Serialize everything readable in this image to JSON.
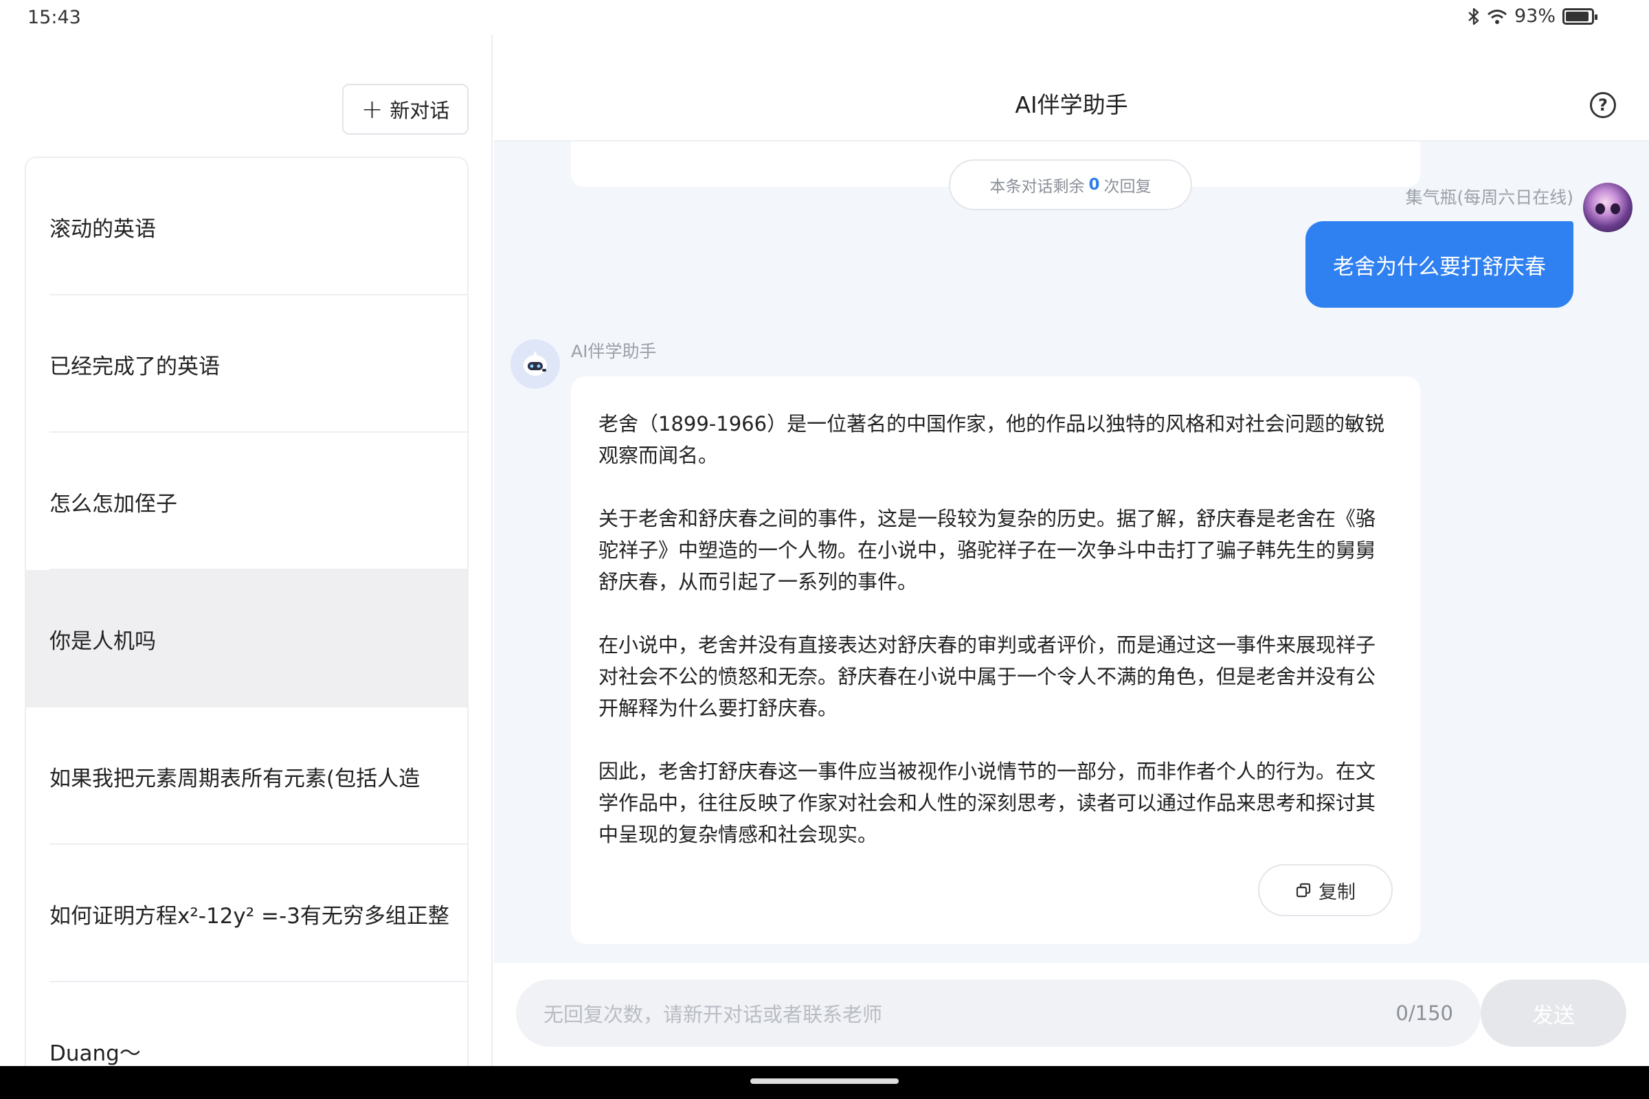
{
  "status_bar": {
    "time": "15:43",
    "battery_percent": "93%",
    "battery_level": 0.93,
    "icons": [
      "bluetooth-icon",
      "wifi-icon",
      "battery-icon"
    ]
  },
  "sidebar": {
    "new_chat_label": "新对话",
    "conversations": [
      {
        "title": "滚动的英语",
        "active": false
      },
      {
        "title": "已经完成了的英语",
        "active": false
      },
      {
        "title": "怎么怎加侄子",
        "active": false
      },
      {
        "title": "你是人机吗",
        "active": true
      },
      {
        "title": "如果我把元素周期表所有元素(包括人造",
        "active": false
      },
      {
        "title": "如何证明方程x²-12y² =-3有无穷多组正整",
        "active": false
      },
      {
        "title": "Duang～",
        "active": false
      }
    ]
  },
  "header": {
    "title": "AI伴学助手"
  },
  "chat": {
    "remaining": {
      "prefix": "本条对话剩余",
      "count": "0",
      "suffix": "次回复"
    },
    "user": {
      "name": "集气瓶(每周六日在线)",
      "message": "老舍为什么要打舒庆春"
    },
    "bot": {
      "name": "AI伴学助手",
      "paragraphs": [
        "老舍（1899-1966）是一位著名的中国作家，他的作品以独特的风格和对社会问题的敏锐观察而闻名。",
        "关于老舍和舒庆春之间的事件，这是一段较为复杂的历史。据了解，舒庆春是老舍在《骆驼祥子》中塑造的一个人物。在小说中，骆驼祥子在一次争斗中击打了骗子韩先生的舅舅舒庆春，从而引起了一系列的事件。",
        "在小说中，老舍并没有直接表达对舒庆春的审判或者评价，而是通过这一事件来展现祥子对社会不公的愤怒和无奈。舒庆春在小说中属于一个令人不满的角色，但是老舍并没有公开解释为什么要打舒庆春。",
        "因此，老舍打舒庆春这一事件应当被视作小说情节的一部分，而非作者个人的行为。在文学作品中，往往反映了作家对社会和人性的深刻思考，读者可以通过作品来思考和探讨其中呈现的复杂情感和社会现实。"
      ],
      "copy_label": "复制"
    }
  },
  "input": {
    "placeholder": "无回复次数，请新开对话或者联系老师",
    "counter": "0/150",
    "send_label": "发送"
  },
  "colors": {
    "accent": "#2f80f0",
    "chat_bg": "#f3f6fb",
    "active_item_bg": "#efeff1"
  }
}
